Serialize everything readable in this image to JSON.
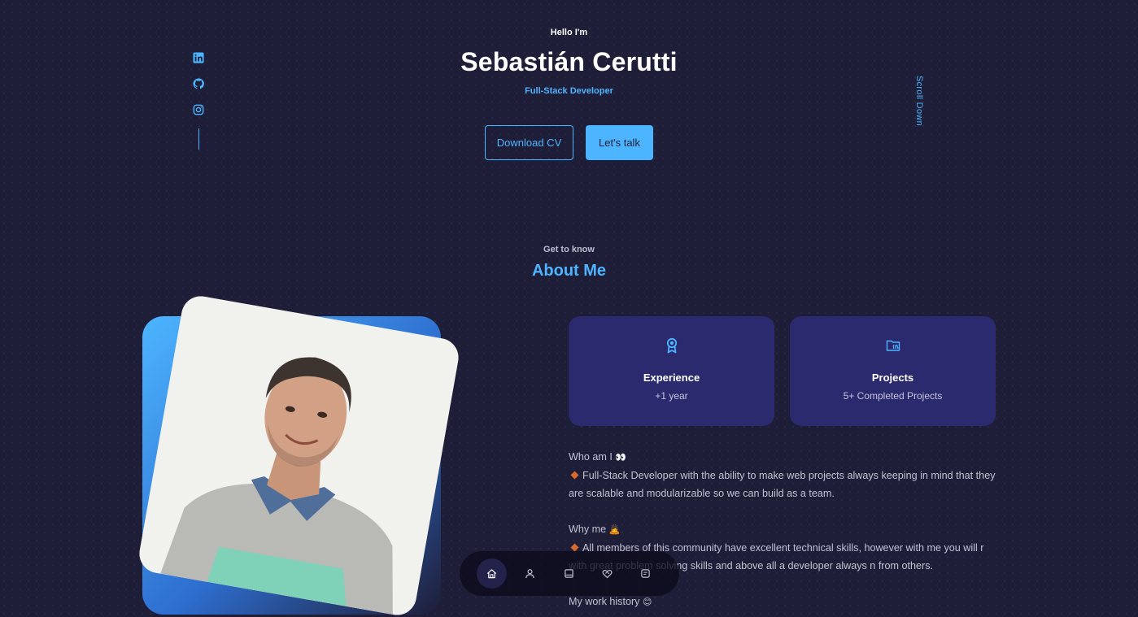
{
  "hero": {
    "intro": "Hello I'm",
    "name": "Sebastián Cerutti",
    "role": "Full-Stack Developer",
    "download_cv": "Download CV",
    "lets_talk": "Let's talk",
    "scroll_down": "Scroll Down"
  },
  "socials": [
    {
      "icon": "linkedin-icon"
    },
    {
      "icon": "github-icon"
    },
    {
      "icon": "instagram-icon"
    }
  ],
  "about": {
    "subtitle": "Get to know",
    "title": "About Me",
    "cards": [
      {
        "icon": "award-icon",
        "title": "Experience",
        "value": "+1 year"
      },
      {
        "icon": "folder-icon",
        "title": "Projects",
        "value": "5+ Completed Projects"
      }
    ],
    "who_heading": "Who am I",
    "who_emoji": "👀",
    "who_text": "Full-Stack Developer with the ability to make web projects always keeping in mind that they are scalable and modularizable so we can build as a team.",
    "why_heading": "Why me",
    "why_emoji": "🙇",
    "why_text": "All members of this community have excellent technical skills, however with me you will r with great problem solving skills and above all a developer always n from others.",
    "work_heading": "My work history",
    "work_emoji": "😊"
  },
  "nav": {
    "items": [
      "home-icon",
      "user-icon",
      "book-icon",
      "handshake-icon",
      "message-icon"
    ],
    "active": "home-icon"
  },
  "colors": {
    "background": "#1f1e38",
    "accent": "#4db5ff",
    "card": "#2c2a6e"
  }
}
